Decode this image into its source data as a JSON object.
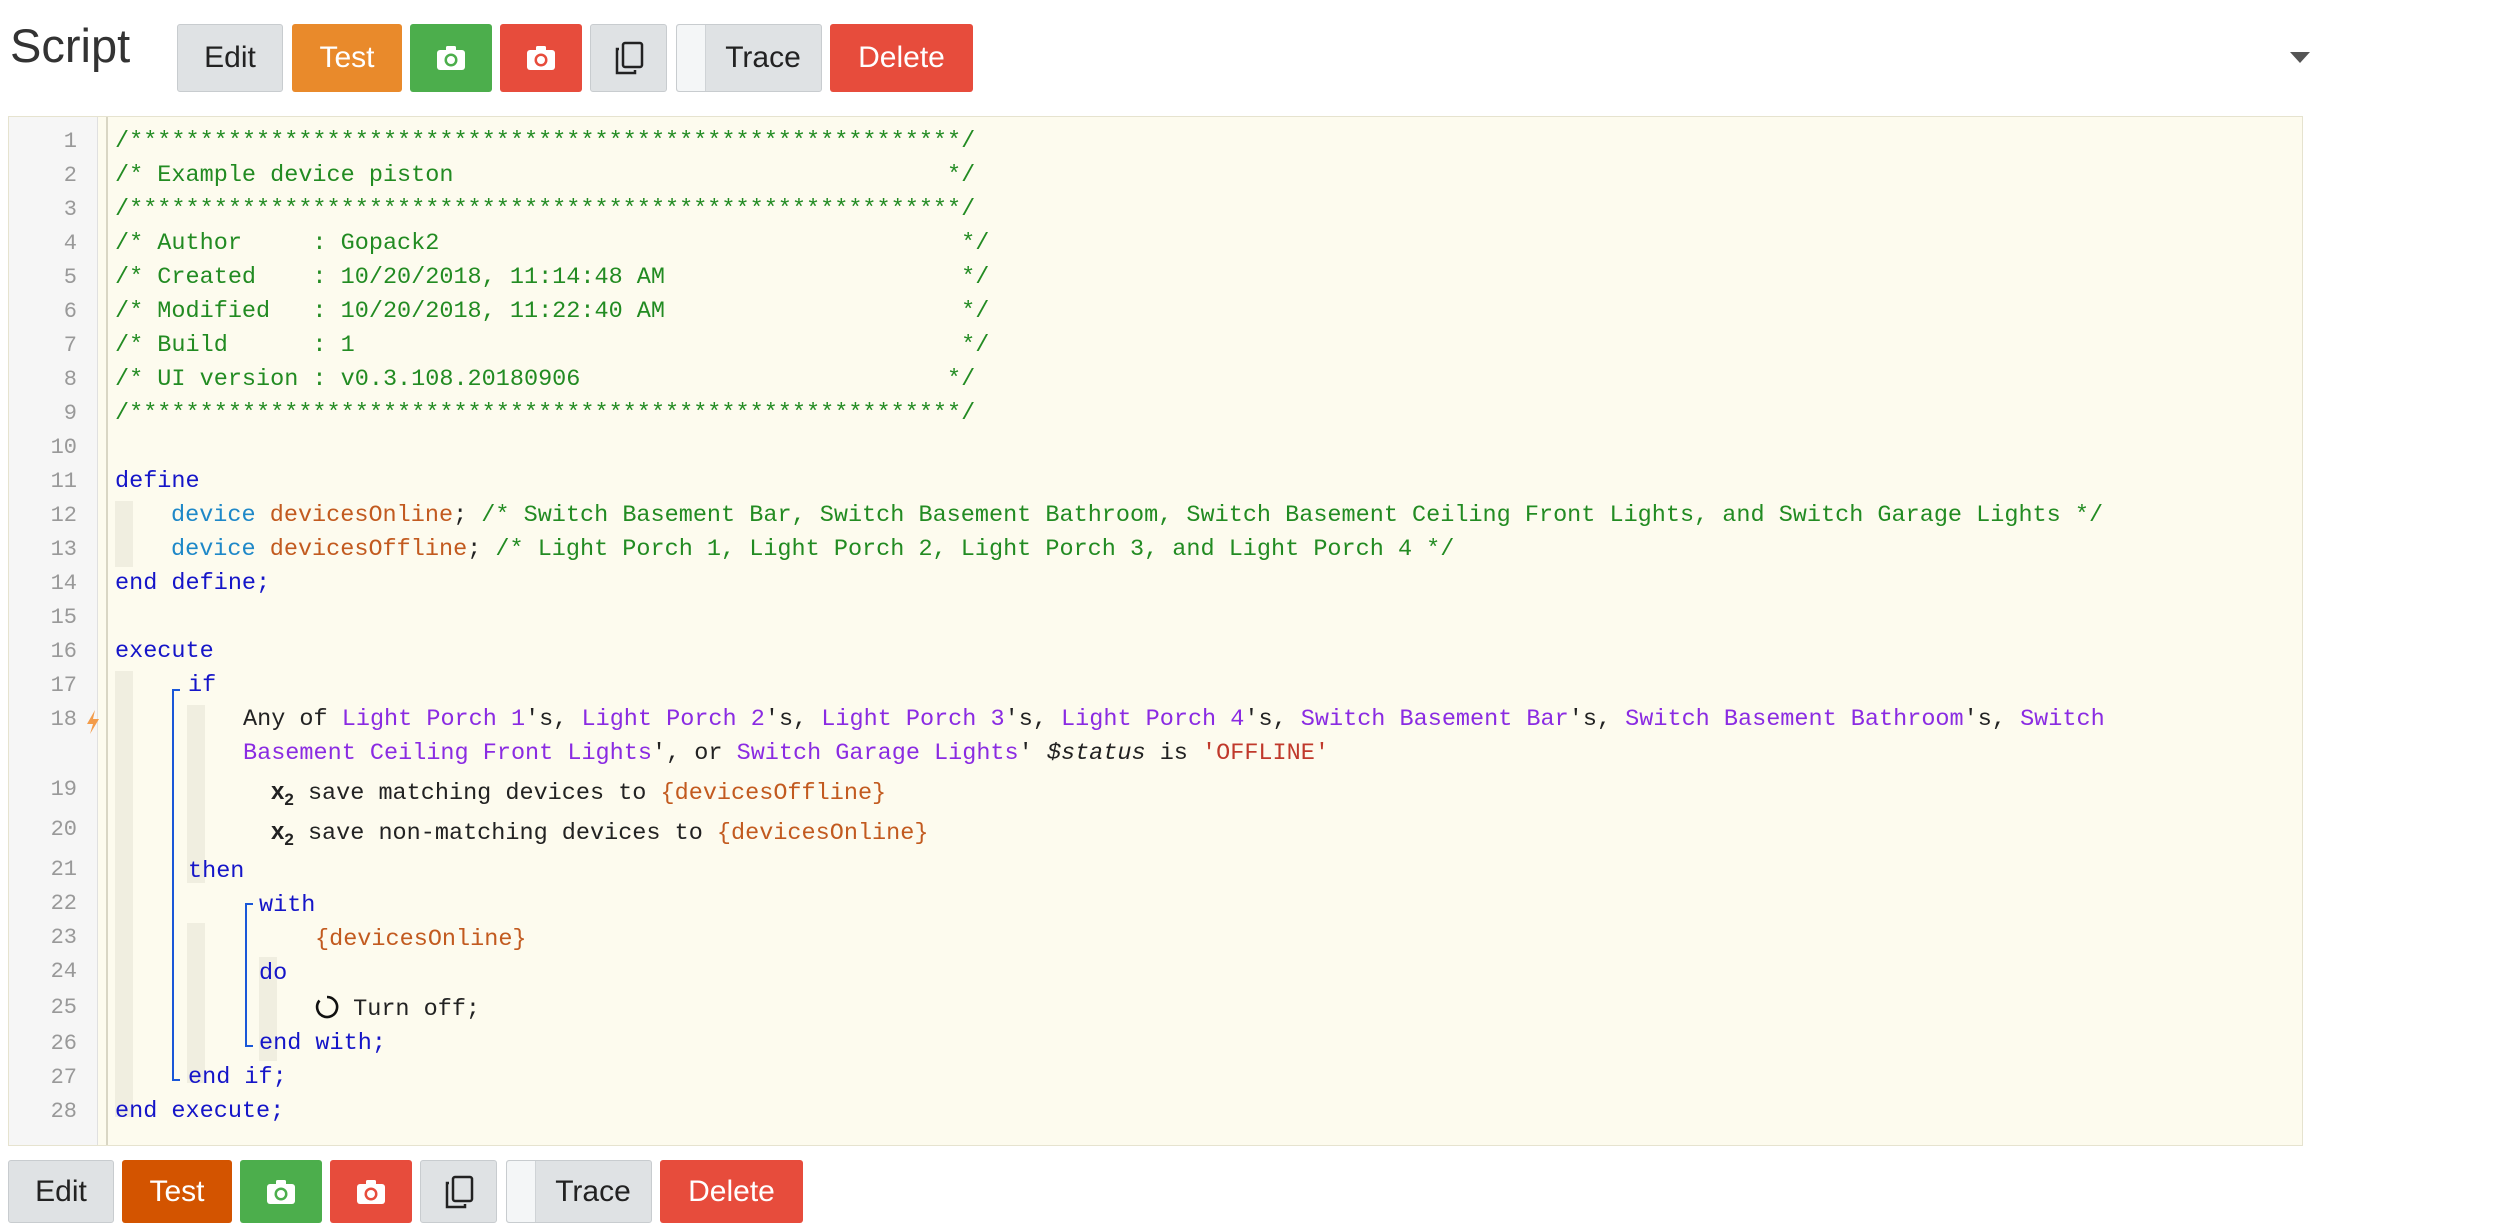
{
  "title": "Script",
  "toolbar": {
    "edit_label": "Edit",
    "test_label": "Test",
    "trace_label": "Trace",
    "delete_label": "Delete",
    "colors": {
      "orange": "#e98a2b",
      "green": "#4cae4c",
      "red": "#e74c3c",
      "gray": "#dfe2e4",
      "test_bottom": "#d35400"
    }
  },
  "icons": {
    "snapshot_green": "camera-icon",
    "snapshot_red": "camera-icon",
    "duplicate": "copy-icon",
    "dropdown": "chevron-down-icon",
    "event": "lightning-icon",
    "save": "subscript-x2-icon",
    "command": "power-icon"
  },
  "code": {
    "line_numbers": [
      "1",
      "2",
      "3",
      "4",
      "5",
      "6",
      "7",
      "8",
      "9",
      "10",
      "11",
      "12",
      "13",
      "14",
      "15",
      "16",
      "17",
      "18",
      "19",
      "20",
      "21",
      "22",
      "23",
      "24",
      "25",
      "26",
      "27",
      "28"
    ],
    "header": {
      "stars": "/***********************************************************/",
      "title": "/* Example device piston                                   */",
      "author": "/* Author     : Gopack2                                     */",
      "created": "/* Created    : 10/20/2018, 11:14:48 AM                     */",
      "modified": "/* Modified   : 10/20/2018, 11:22:40 AM                     */",
      "build": "/* Build      : 1                                           */",
      "ui_version": "/* UI version : v0.3.108.20180906                          */"
    },
    "kw_define": "define",
    "kw_device": "device",
    "var_online": "devicesOnline",
    "online_comment": "/* Switch Basement Bar, Switch Basement Bathroom, Switch Basement Ceiling Front Lights, and Switch Garage Lights */",
    "var_offline": "devicesOffline",
    "offline_comment": "/* Light Porch 1, Light Porch 2, Light Porch 3, and Light Porch 4 */",
    "kw_end_define": "end define;",
    "kw_execute": "execute",
    "kw_if": "if",
    "any_of": "Any of",
    "devices": [
      "Light Porch 1",
      "Light Porch 2",
      "Light Porch 3",
      "Light Porch 4",
      "Switch Basement Bar",
      "Switch Basement Bathroom",
      "Switch",
      "Basement Ceiling Front Lights",
      "Switch Garage Lights"
    ],
    "possessive": "'s,",
    "or_text": "', or",
    "quote": "'",
    "status_attr": "$status",
    "is_text": "is",
    "status_value": "'OFFLINE'",
    "save_matching": "save matching devices to",
    "save_matching_var": "{devicesOffline}",
    "save_nonmatching": "save non-matching devices to",
    "save_nonmatching_var": "{devicesOnline}",
    "kw_then": "then",
    "kw_with": "with",
    "with_var": "{devicesOnline}",
    "kw_do": "do",
    "command": "Turn off;",
    "kw_end_with": "end with;",
    "kw_end_if": "end if;",
    "kw_end_execute": "end execute;"
  }
}
